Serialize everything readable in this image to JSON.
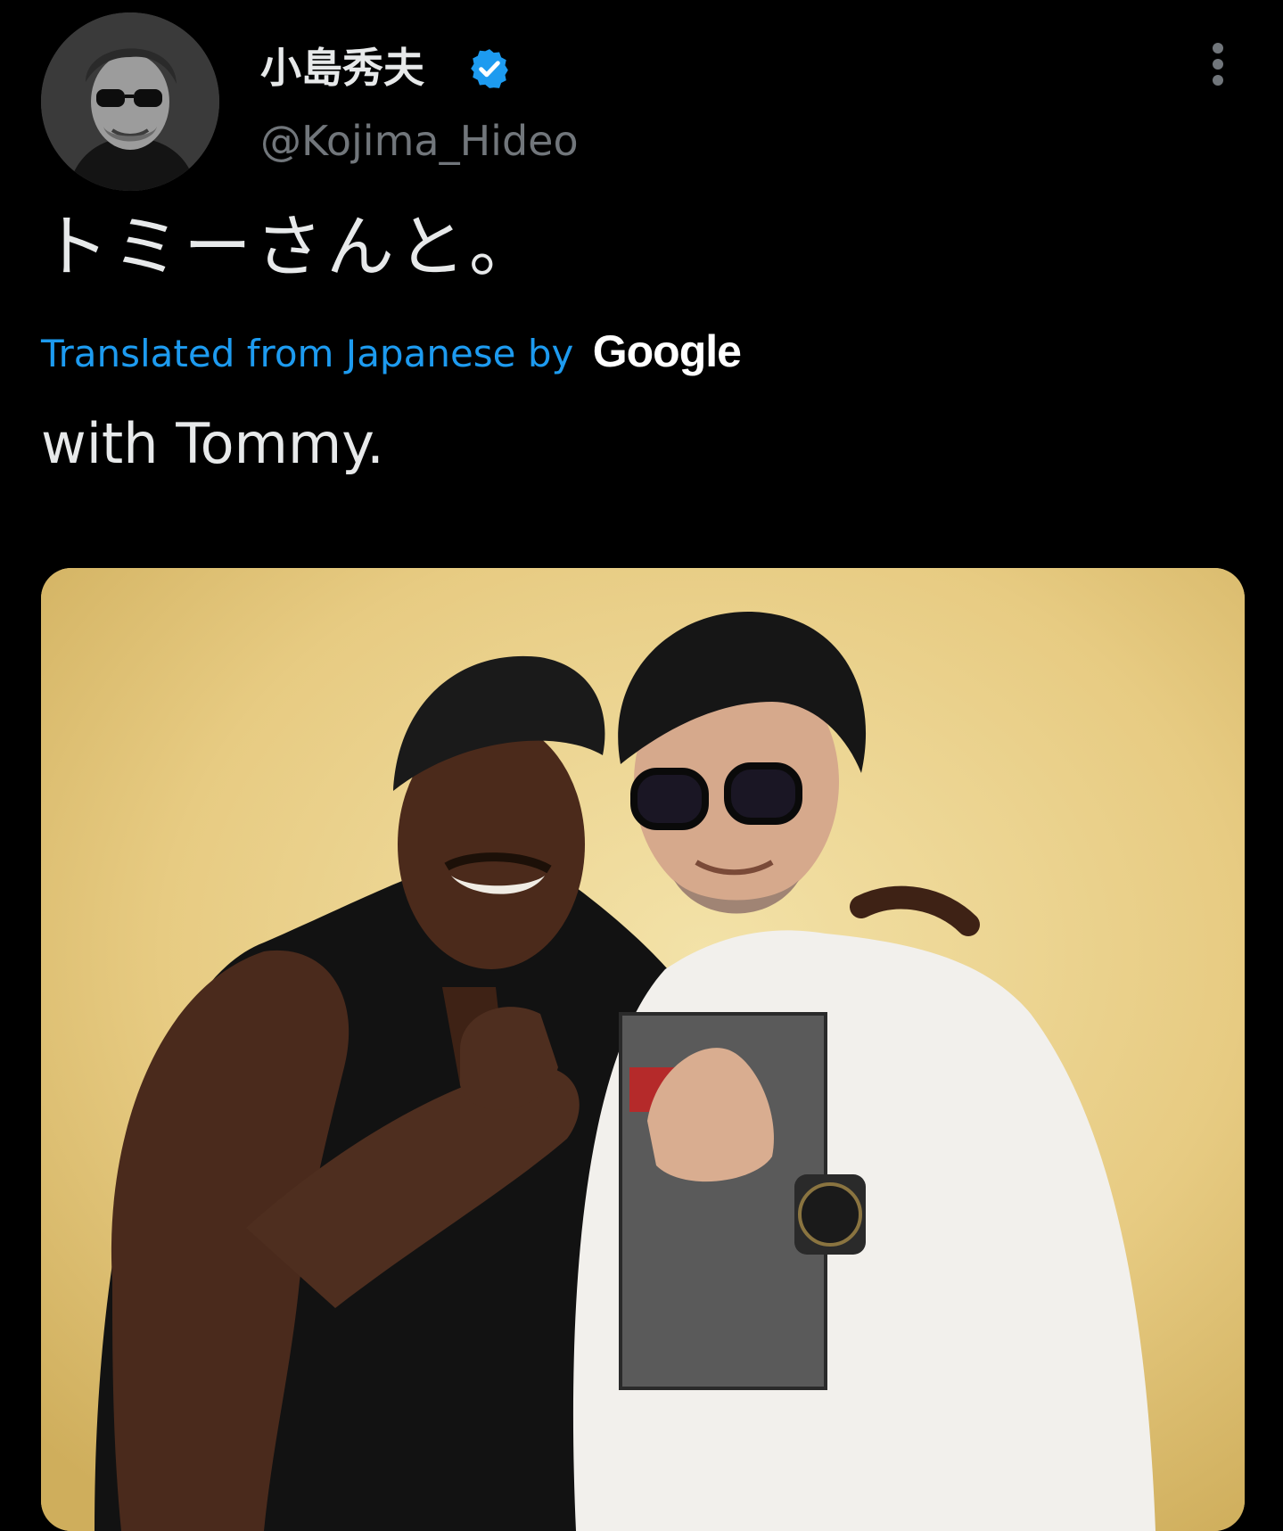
{
  "author": {
    "display_name": "小島秀夫",
    "handle": "@Kojima_Hideo",
    "verified": true
  },
  "tweet": {
    "text": "トミーさんと。",
    "translation_label": "Translated from Japanese by",
    "translation_provider": "Google",
    "translated_text": "with Tommy."
  },
  "icons": {
    "verified": "verified-badge-icon",
    "more": "more-options-icon"
  },
  "colors": {
    "background": "#000000",
    "primary_text": "#e7e9ea",
    "secondary_text": "#71767b",
    "link": "#1d9bf0",
    "verified_badge": "#1d9bf0",
    "photo_wall": "#ecd38e"
  }
}
